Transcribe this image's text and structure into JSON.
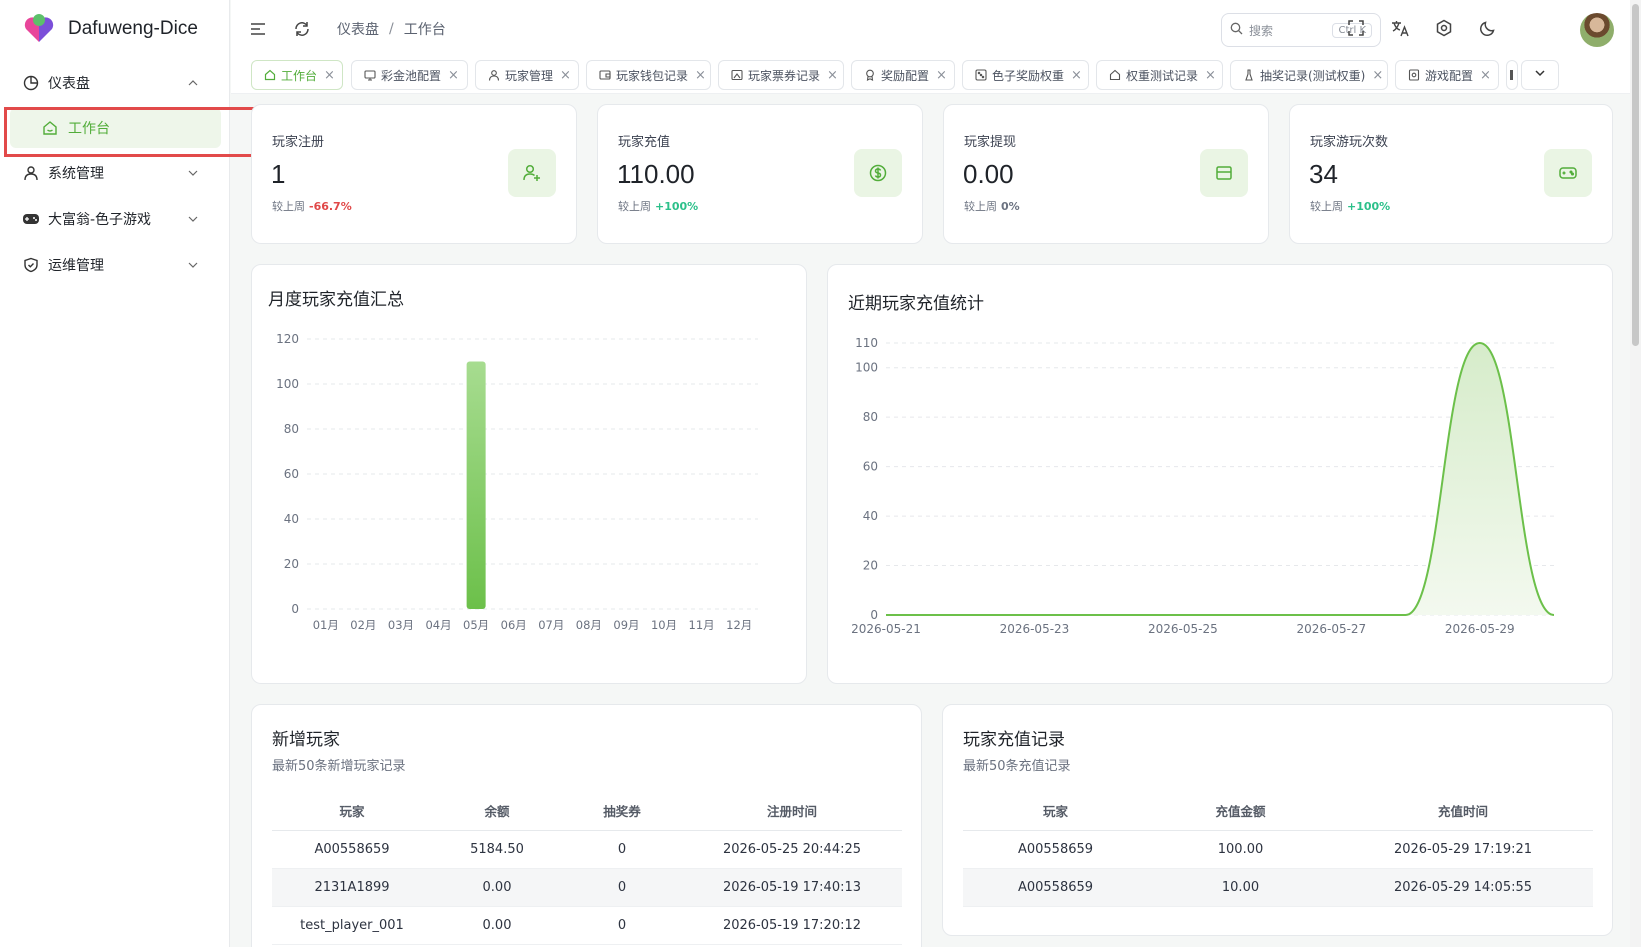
{
  "app": {
    "title": "Dafuweng-Dice"
  },
  "sidebar": {
    "items": [
      {
        "label": "仪表盘",
        "icon": "pie-chart-icon",
        "expanded": true
      },
      {
        "label": "工作台",
        "icon": "workspace-icon",
        "active": true
      },
      {
        "label": "系统管理",
        "icon": "user-icon"
      },
      {
        "label": "大富翁-色子游戏",
        "icon": "gamepad-icon"
      },
      {
        "label": "运维管理",
        "icon": "shield-icon"
      }
    ]
  },
  "header": {
    "breadcrumb": [
      "仪表盘",
      "工作台"
    ],
    "breadcrumb_sep": "/",
    "search_placeholder": "搜索",
    "search_shortcut": "Ctrl K"
  },
  "tabs": [
    {
      "label": "工作台",
      "active": true,
      "icon": "home-icon"
    },
    {
      "label": "彩金池配置",
      "icon": "coins-icon"
    },
    {
      "label": "玩家管理",
      "icon": "user-icon"
    },
    {
      "label": "玩家钱包记录",
      "icon": "wallet-icon"
    },
    {
      "label": "玩家票券记录",
      "icon": "ticket-icon"
    },
    {
      "label": "奖励配置",
      "icon": "award-icon"
    },
    {
      "label": "色子奖励权重",
      "icon": "dice-icon"
    },
    {
      "label": "权重测试记录",
      "icon": "home-outline-icon"
    },
    {
      "label": "抽奖记录(测试权重)",
      "icon": "flask-icon"
    },
    {
      "label": "游戏配置",
      "icon": "settings-doc-icon"
    }
  ],
  "stats": [
    {
      "label": "玩家注册",
      "value": "1",
      "compare_label": "较上周",
      "change": "-66.7%",
      "change_color": "#e04848",
      "icon": "user-plus-icon"
    },
    {
      "label": "玩家充值",
      "value": "110.00",
      "compare_label": "较上周",
      "change": "+100%",
      "change_color": "#2cc08a",
      "icon": "dollar-circle-icon"
    },
    {
      "label": "玩家提现",
      "value": "0.00",
      "compare_label": "较上周",
      "change": "0%",
      "change_color": "#6b7280",
      "icon": "card-icon"
    },
    {
      "label": "玩家游玩次数",
      "value": "34",
      "compare_label": "较上周",
      "change": "+100%",
      "change_color": "#2cc08a",
      "icon": "gamepad-icon"
    }
  ],
  "chart_data": [
    {
      "type": "bar",
      "title": "月度玩家充值汇总",
      "categories": [
        "01月",
        "02月",
        "03月",
        "04月",
        "05月",
        "06月",
        "07月",
        "08月",
        "09月",
        "10月",
        "11月",
        "12月"
      ],
      "values": [
        0,
        0,
        0,
        0,
        110,
        0,
        0,
        0,
        0,
        0,
        0,
        0
      ],
      "ylim": [
        0,
        120
      ],
      "yticks": [
        0,
        20,
        40,
        60,
        80,
        100,
        120
      ],
      "grid": true,
      "color": "#6cc04a"
    },
    {
      "type": "area",
      "title": "近期玩家充值统计",
      "x": [
        "2026-05-21",
        "2026-05-22",
        "2026-05-23",
        "2026-05-24",
        "2026-05-25",
        "2026-05-26",
        "2026-05-27",
        "2026-05-28",
        "2026-05-29",
        "2026-05-30"
      ],
      "xticks": [
        "2026-05-21",
        "2026-05-23",
        "2026-05-25",
        "2026-05-27",
        "2026-05-29"
      ],
      "values": [
        0,
        0,
        0,
        0,
        0,
        0,
        0,
        0,
        110,
        0
      ],
      "ylim": [
        0,
        110
      ],
      "yticks": [
        0,
        20,
        40,
        60,
        80,
        100,
        110
      ],
      "grid": true,
      "color": "#6cc04a"
    }
  ],
  "new_players": {
    "title": "新增玩家",
    "subtitle": "最新50条新增玩家记录",
    "columns": [
      "玩家",
      "余额",
      "抽奖券",
      "注册时间"
    ],
    "rows": [
      [
        "A00558659",
        "5184.50",
        "0",
        "2026-05-25 20:44:25"
      ],
      [
        "2131A1899",
        "0.00",
        "0",
        "2026-05-19 17:40:13"
      ],
      [
        "test_player_001",
        "0.00",
        "0",
        "2026-05-19 17:20:12"
      ]
    ]
  },
  "recharges": {
    "title": "玩家充值记录",
    "subtitle": "最新50条充值记录",
    "columns": [
      "玩家",
      "充值金额",
      "充值时间"
    ],
    "rows": [
      [
        "A00558659",
        "100.00",
        "2026-05-29 17:19:21"
      ],
      [
        "A00558659",
        "10.00",
        "2026-05-29 14:05:55"
      ]
    ]
  }
}
